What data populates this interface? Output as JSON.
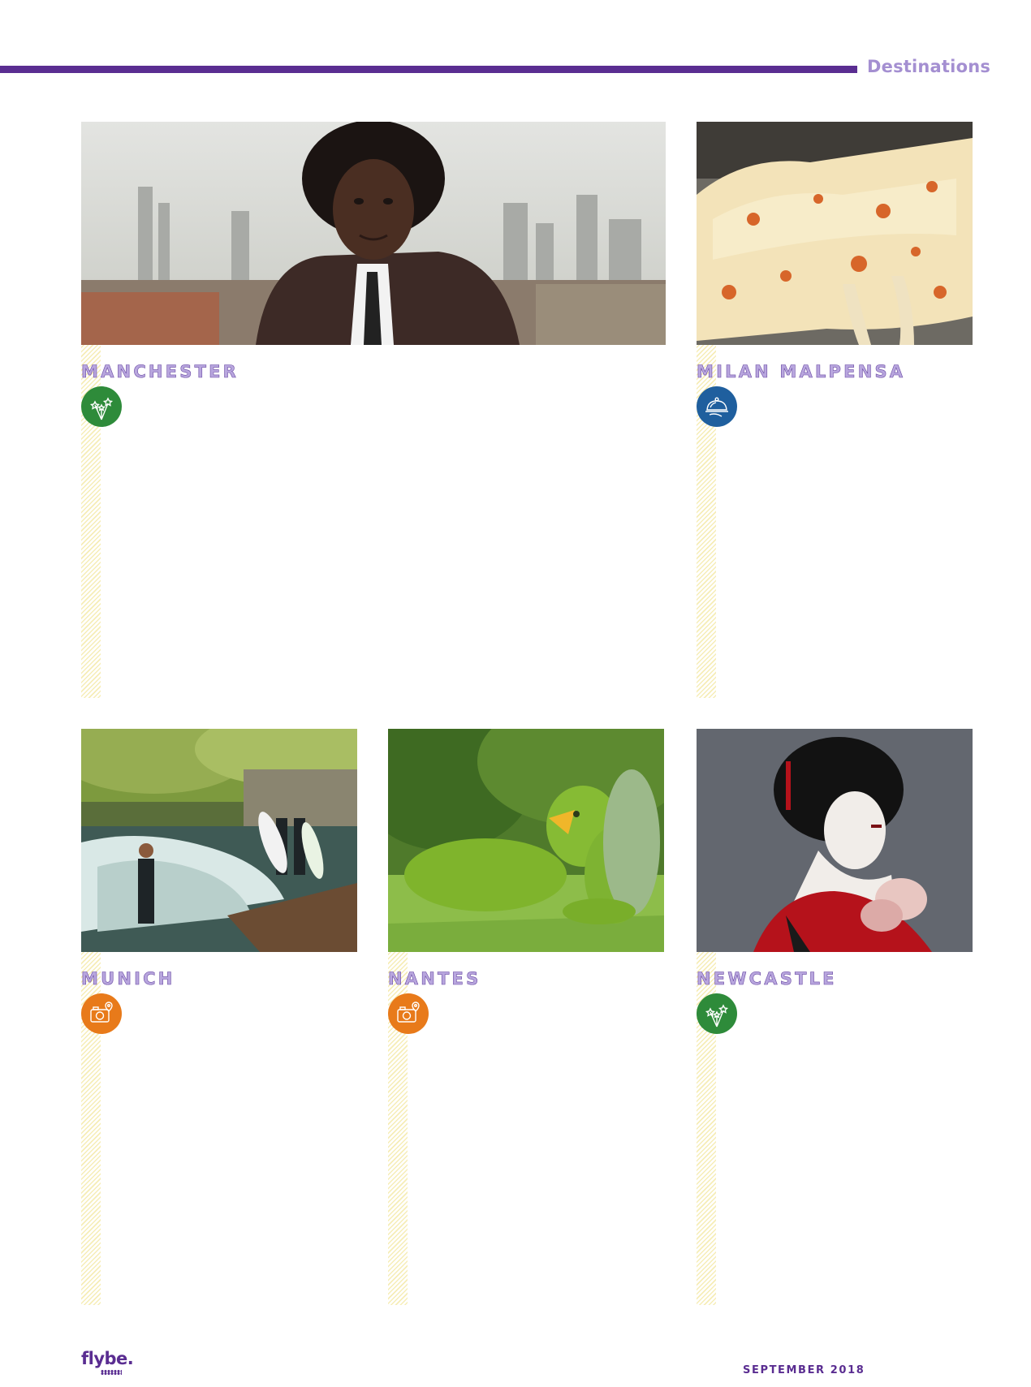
{
  "header": {
    "section": "Destinations"
  },
  "colors": {
    "brand_purple": "#5a2d91",
    "title_purple": "#b8a6de",
    "stripe_yellow": "#f6edb7",
    "events_green": "#2e8b3a",
    "food_blue": "#1f5f9e",
    "sights_orange": "#e87a1a"
  },
  "destinations": [
    {
      "name": "MANCHESTER",
      "icon": "fireworks-icon",
      "photo": "man-portrait-city-skyline-photo"
    },
    {
      "name": "MILAN MALPENSA",
      "icon": "dining-cloche-icon",
      "photo": "melted-cheese-pizza-photo"
    },
    {
      "name": "MUNICH",
      "icon": "camera-pin-icon",
      "photo": "river-surfers-photo"
    },
    {
      "name": "NANTES",
      "icon": "camera-pin-icon",
      "photo": "topiary-bird-garden-photo"
    },
    {
      "name": "NEWCASTLE",
      "icon": "fireworks-icon",
      "photo": "geisha-portrait-photo"
    }
  ],
  "footer": {
    "logo": "flybe.",
    "date": "SEPTEMBER 2018"
  }
}
